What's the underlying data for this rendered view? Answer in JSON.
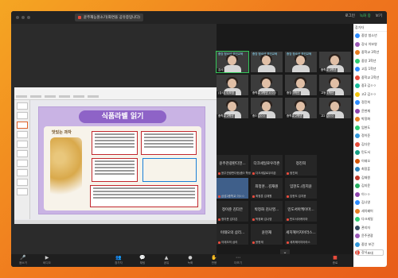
{
  "window": {
    "share_title": "윤주재능원소기(화면을 공유중입니다)",
    "top_right": [
      "로그인",
      "녹화 중",
      "보기"
    ]
  },
  "slide": {
    "title": "식품라벨 읽기",
    "snack_name": "맛있는 과자"
  },
  "gallery": {
    "video_tiles": [
      {
        "banner": "중앙 청소년 보건교육",
        "tag": "강사",
        "active": true
      },
      {
        "banner": "중앙 청소년 보건교육",
        "tag": "",
        "active": false
      },
      {
        "banner": "중앙 청소년 보건교육",
        "tag": "",
        "active": false
      },
      {
        "banner": "",
        "tag": "(강사) 이보영",
        "active": false
      },
      {
        "banner": "",
        "tag": "중학교 3학년 ㅇㅇㅇ",
        "active": false
      },
      {
        "banner": "",
        "tag": "중앙 3학년",
        "active": false
      },
      {
        "banner": "",
        "tag": "고등 1학년",
        "active": false
      },
      {
        "banner": "",
        "tag": "중학교 2학년",
        "active": false
      },
      {
        "banner": "",
        "tag": "중3 김ㅇㅇ",
        "active": false
      },
      {
        "banner": "",
        "tag": "중학교 2학년",
        "active": false
      },
      {
        "banner": "",
        "tag": "고2 김ㅇㅇ",
        "active": false
      },
      {
        "banner": "",
        "tag": "중학교 3학년",
        "active": false
      }
    ],
    "name_tiles": [
      {
        "name": "윤주관광판다헌...",
        "tag": "윤주관광판다헌(중3 학생)"
      },
      {
        "name": "다크세일로우리존",
        "tag": "다크세일로우리존"
      },
      {
        "name": "정진희",
        "tag": "정진희"
      },
      {
        "name": "",
        "tag": "삼성2중학교 이ㅇㅇ"
      },
      {
        "name": "최정훈...김재원",
        "tag": "최정훈 김재원"
      },
      {
        "name": "임현도./김지윤",
        "tag": "임현도 김지윤"
      },
      {
        "name": "정이준 김다은",
        "tag": "정이준 김다은"
      },
      {
        "name": "박정화 김나영...",
        "tag": "박정화 김나영"
      },
      {
        "name": "민도서아케이마...",
        "tag": "민도서아케이마"
      },
      {
        "name": "이태오의 삼리...",
        "tag": "이태오의 삼리"
      },
      {
        "name": "윤현재",
        "tag": "윤현재"
      },
      {
        "name": "세치혜어지아라스...",
        "tag": "세치혜어지아라스"
      }
    ]
  },
  "panel": {
    "header": "참가자",
    "participants": [
      {
        "name": "중앙 청소년",
        "color": "#2d8cff"
      },
      {
        "name": "강사 이보영",
        "color": "#9b59b6"
      },
      {
        "name": "중학교 3학년",
        "color": "#e67e22"
      },
      {
        "name": "중앙 3학년",
        "color": "#2ecc71"
      },
      {
        "name": "고등 1학년",
        "color": "#2d8cff"
      },
      {
        "name": "중학교 2학년",
        "color": "#e74c3c"
      },
      {
        "name": "중3 김ㅇㅇ",
        "color": "#1abc9c"
      },
      {
        "name": "고2 김ㅇㅇ",
        "color": "#f1c40f"
      },
      {
        "name": "정진희",
        "color": "#2d8cff"
      },
      {
        "name": "윤현재",
        "color": "#8e44ad"
      },
      {
        "name": "박정화",
        "color": "#e67e22"
      },
      {
        "name": "임현도",
        "color": "#2ecc71"
      },
      {
        "name": "정이준",
        "color": "#3498db"
      },
      {
        "name": "김다은",
        "color": "#e74c3c"
      },
      {
        "name": "민도서",
        "color": "#16a085"
      },
      {
        "name": "이태오",
        "color": "#d35400"
      },
      {
        "name": "최정훈",
        "color": "#2980b9"
      },
      {
        "name": "김재원",
        "color": "#c0392b"
      },
      {
        "name": "김지윤",
        "color": "#27ae60"
      },
      {
        "name": "이ㅇㅇ",
        "color": "#8e44ad"
      },
      {
        "name": "김나영",
        "color": "#2d8cff"
      },
      {
        "name": "세치혜어",
        "color": "#e67e22"
      },
      {
        "name": "다크세일",
        "color": "#2ecc71"
      },
      {
        "name": "관리자",
        "color": "#34495e"
      },
      {
        "name": "윤주관광",
        "color": "#9b59b6"
      },
      {
        "name": "중앙 보건",
        "color": "#3498db"
      },
      {
        "name": "강사",
        "color": "#e74c3c"
      }
    ],
    "footer_button": "초대"
  },
  "toolbar": {
    "items": [
      {
        "icon": "🎤",
        "label": "음소거"
      },
      {
        "icon": "▶",
        "label": "비디오"
      },
      {
        "icon": "👥",
        "label": "참가자"
      },
      {
        "icon": "💬",
        "label": "채팅"
      },
      {
        "icon": "▲",
        "label": "공유"
      },
      {
        "icon": "●",
        "label": "녹화"
      },
      {
        "icon": "✋",
        "label": "반응"
      },
      {
        "icon": "⋯",
        "label": "더보기"
      }
    ],
    "end_label": "종료"
  }
}
